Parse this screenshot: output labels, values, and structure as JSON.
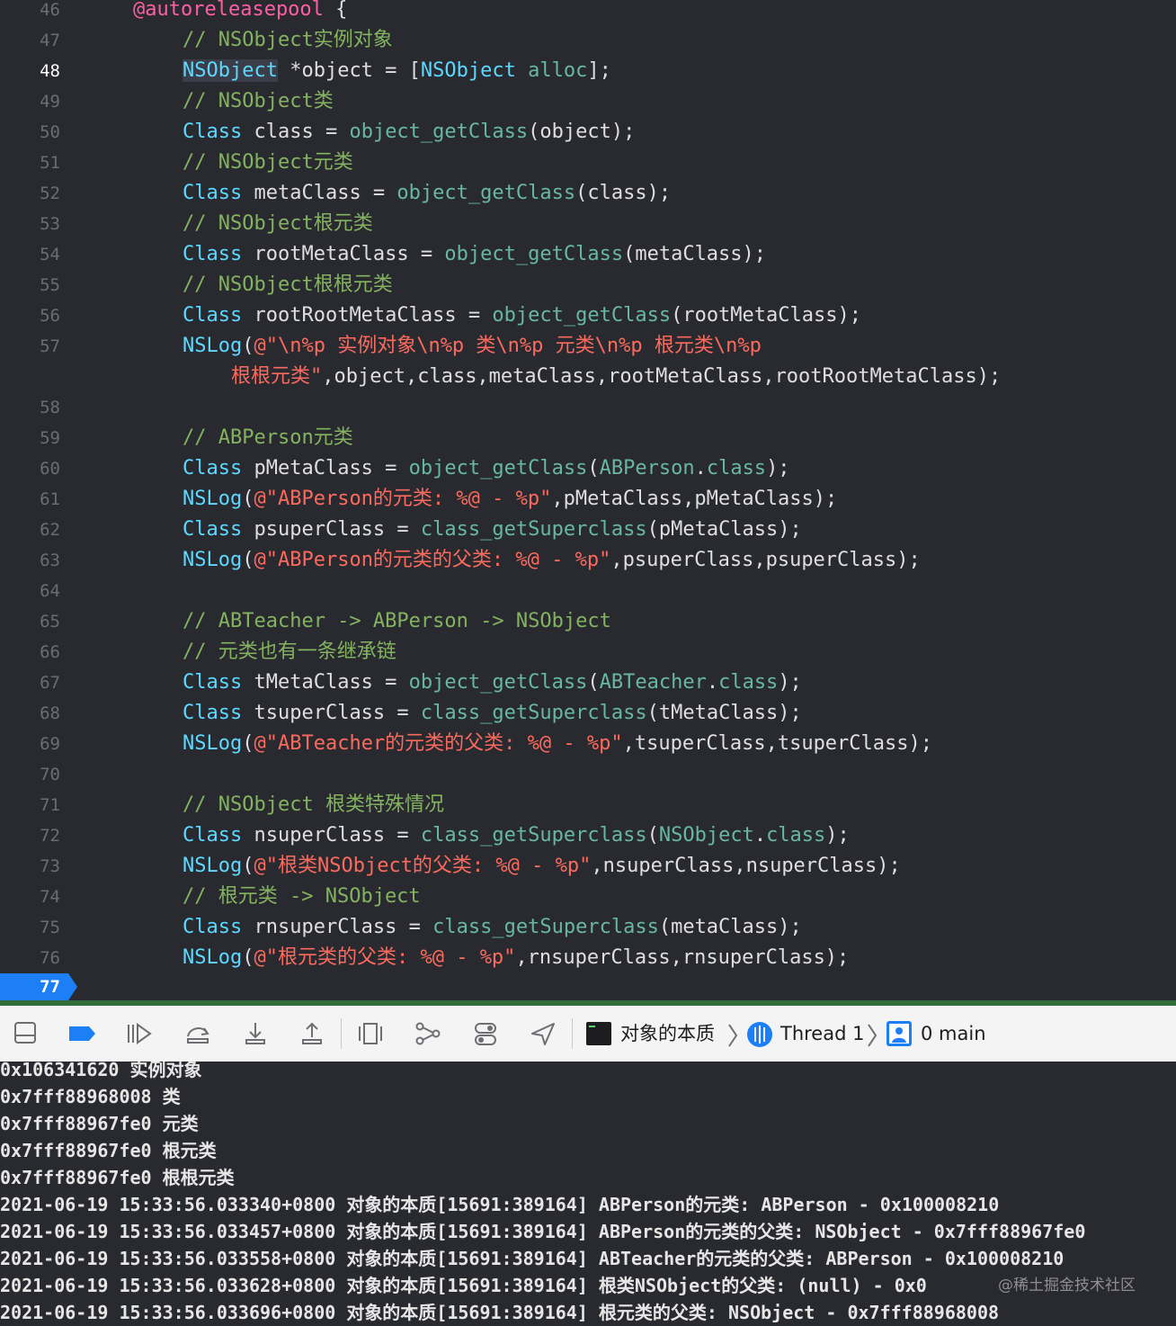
{
  "editor": {
    "lines": [
      {
        "number": "46",
        "tokens": [
          {
            "t": "@autoreleasepool",
            "c": "kw"
          },
          {
            "t": " {",
            "c": "pl"
          }
        ]
      },
      {
        "number": "47",
        "tokens": [
          {
            "t": "// NSObject实例对象",
            "c": "cm"
          }
        ]
      },
      {
        "number": "48",
        "current": true,
        "tokens": [
          {
            "t": "NSObject",
            "c": "ty hl"
          },
          {
            "t": " *object = [",
            "c": "pl"
          },
          {
            "t": "NSObject",
            "c": "ty"
          },
          {
            "t": " ",
            "c": "pl"
          },
          {
            "t": "alloc",
            "c": "fn"
          },
          {
            "t": "];",
            "c": "pl"
          }
        ]
      },
      {
        "number": "49",
        "tokens": [
          {
            "t": "// NSObject类",
            "c": "cm"
          }
        ]
      },
      {
        "number": "50",
        "tokens": [
          {
            "t": "Class",
            "c": "ty"
          },
          {
            "t": " class = ",
            "c": "pl"
          },
          {
            "t": "object_getClass",
            "c": "fn"
          },
          {
            "t": "(object);",
            "c": "pl"
          }
        ]
      },
      {
        "number": "51",
        "tokens": [
          {
            "t": "// NSObject元类",
            "c": "cm"
          }
        ]
      },
      {
        "number": "52",
        "tokens": [
          {
            "t": "Class",
            "c": "ty"
          },
          {
            "t": " metaClass = ",
            "c": "pl"
          },
          {
            "t": "object_getClass",
            "c": "fn"
          },
          {
            "t": "(class);",
            "c": "pl"
          }
        ]
      },
      {
        "number": "53",
        "tokens": [
          {
            "t": "// NSObject根元类",
            "c": "cm"
          }
        ]
      },
      {
        "number": "54",
        "tokens": [
          {
            "t": "Class",
            "c": "ty"
          },
          {
            "t": " rootMetaClass = ",
            "c": "pl"
          },
          {
            "t": "object_getClass",
            "c": "fn"
          },
          {
            "t": "(metaClass);",
            "c": "pl"
          }
        ]
      },
      {
        "number": "55",
        "tokens": [
          {
            "t": "// NSObject根根元类",
            "c": "cm"
          }
        ]
      },
      {
        "number": "56",
        "tokens": [
          {
            "t": "Class",
            "c": "ty"
          },
          {
            "t": " rootRootMetaClass = ",
            "c": "pl"
          },
          {
            "t": "object_getClass",
            "c": "fn"
          },
          {
            "t": "(rootMetaClass);",
            "c": "pl"
          }
        ]
      },
      {
        "number": "57",
        "tokens": [
          {
            "t": "NSLog",
            "c": "ty"
          },
          {
            "t": "(",
            "c": "pl"
          },
          {
            "t": "@\"\\n%p 实例对象\\n%p 类\\n%p 元类\\n%p 根元类\\n%p",
            "c": "st"
          }
        ]
      },
      {
        "number": "",
        "cont": true,
        "tokens": [
          {
            "t": "根根元类\"",
            "c": "st"
          },
          {
            "t": ",object,class,metaClass,rootMetaClass,rootRootMetaClass);",
            "c": "pl"
          }
        ]
      },
      {
        "number": "58",
        "tokens": []
      },
      {
        "number": "59",
        "tokens": [
          {
            "t": "// ABPerson元类",
            "c": "cm"
          }
        ]
      },
      {
        "number": "60",
        "tokens": [
          {
            "t": "Class",
            "c": "ty"
          },
          {
            "t": " pMetaClass = ",
            "c": "pl"
          },
          {
            "t": "object_getClass",
            "c": "fn"
          },
          {
            "t": "(",
            "c": "pl"
          },
          {
            "t": "ABPerson",
            "c": "fn"
          },
          {
            "t": ".",
            "c": "pl"
          },
          {
            "t": "class",
            "c": "fn"
          },
          {
            "t": ");",
            "c": "pl"
          }
        ]
      },
      {
        "number": "61",
        "tokens": [
          {
            "t": "NSLog",
            "c": "ty"
          },
          {
            "t": "(",
            "c": "pl"
          },
          {
            "t": "@\"ABPerson的元类: %@ - %p\"",
            "c": "st"
          },
          {
            "t": ",pMetaClass,pMetaClass);",
            "c": "pl"
          }
        ]
      },
      {
        "number": "62",
        "tokens": [
          {
            "t": "Class",
            "c": "ty"
          },
          {
            "t": " psuperClass = ",
            "c": "pl"
          },
          {
            "t": "class_getSuperclass",
            "c": "fn"
          },
          {
            "t": "(pMetaClass);",
            "c": "pl"
          }
        ]
      },
      {
        "number": "63",
        "tokens": [
          {
            "t": "NSLog",
            "c": "ty"
          },
          {
            "t": "(",
            "c": "pl"
          },
          {
            "t": "@\"ABPerson的元类的父类: %@ - %p\"",
            "c": "st"
          },
          {
            "t": ",psuperClass,psuperClass);",
            "c": "pl"
          }
        ]
      },
      {
        "number": "64",
        "tokens": []
      },
      {
        "number": "65",
        "tokens": [
          {
            "t": "// ABTeacher -> ABPerson -> NSObject",
            "c": "cm"
          }
        ]
      },
      {
        "number": "66",
        "tokens": [
          {
            "t": "// 元类也有一条继承链",
            "c": "cm"
          }
        ]
      },
      {
        "number": "67",
        "tokens": [
          {
            "t": "Class",
            "c": "ty"
          },
          {
            "t": " tMetaClass = ",
            "c": "pl"
          },
          {
            "t": "object_getClass",
            "c": "fn"
          },
          {
            "t": "(",
            "c": "pl"
          },
          {
            "t": "ABTeacher",
            "c": "fn"
          },
          {
            "t": ".",
            "c": "pl"
          },
          {
            "t": "class",
            "c": "fn"
          },
          {
            "t": ");",
            "c": "pl"
          }
        ]
      },
      {
        "number": "68",
        "tokens": [
          {
            "t": "Class",
            "c": "ty"
          },
          {
            "t": " tsuperClass = ",
            "c": "pl"
          },
          {
            "t": "class_getSuperclass",
            "c": "fn"
          },
          {
            "t": "(tMetaClass);",
            "c": "pl"
          }
        ]
      },
      {
        "number": "69",
        "tokens": [
          {
            "t": "NSLog",
            "c": "ty"
          },
          {
            "t": "(",
            "c": "pl"
          },
          {
            "t": "@\"ABTeacher的元类的父类: %@ - %p\"",
            "c": "st"
          },
          {
            "t": ",tsuperClass,tsuperClass);",
            "c": "pl"
          }
        ]
      },
      {
        "number": "70",
        "tokens": []
      },
      {
        "number": "71",
        "tokens": [
          {
            "t": "// NSObject 根类特殊情况",
            "c": "cm"
          }
        ]
      },
      {
        "number": "72",
        "tokens": [
          {
            "t": "Class",
            "c": "ty"
          },
          {
            "t": " nsuperClass = ",
            "c": "pl"
          },
          {
            "t": "class_getSuperclass",
            "c": "fn"
          },
          {
            "t": "(",
            "c": "pl"
          },
          {
            "t": "NSObject",
            "c": "fn"
          },
          {
            "t": ".",
            "c": "pl"
          },
          {
            "t": "class",
            "c": "fn"
          },
          {
            "t": ");",
            "c": "pl"
          }
        ]
      },
      {
        "number": "73",
        "tokens": [
          {
            "t": "NSLog",
            "c": "ty"
          },
          {
            "t": "(",
            "c": "pl"
          },
          {
            "t": "@\"根类NSObject的父类: %@ - %p\"",
            "c": "st"
          },
          {
            "t": ",nsuperClass,nsuperClass);",
            "c": "pl"
          }
        ]
      },
      {
        "number": "74",
        "tokens": [
          {
            "t": "// 根元类 -> NSObject",
            "c": "cm"
          }
        ]
      },
      {
        "number": "75",
        "tokens": [
          {
            "t": "Class",
            "c": "ty"
          },
          {
            "t": " rnsuperClass = ",
            "c": "pl"
          },
          {
            "t": "class_getSuperclass",
            "c": "fn"
          },
          {
            "t": "(metaClass);",
            "c": "pl"
          }
        ]
      },
      {
        "number": "76",
        "tokens": [
          {
            "t": "NSLog",
            "c": "ty"
          },
          {
            "t": "(",
            "c": "pl"
          },
          {
            "t": "@\"根元类的父类: %@ - %p\"",
            "c": "st"
          },
          {
            "t": ",rnsuperClass,rnsuperClass);",
            "c": "pl"
          }
        ]
      }
    ],
    "breakpoint_line": "77"
  },
  "debug_bar": {
    "buttons": [
      "hide-debug-area",
      "breakpoints-toggle",
      "continue",
      "step-over",
      "step-into",
      "step-out",
      "view-debugger",
      "memory-graph",
      "environment-overrides",
      "simulate-location"
    ],
    "breadcrumb": {
      "target": "对象的本质",
      "thread": "Thread 1",
      "frame": "0 main"
    }
  },
  "console": {
    "lines": [
      "0x106341620 实例对象",
      "0x7fff88968008 类",
      "0x7fff88967fe0 元类",
      "0x7fff88967fe0 根元类",
      "0x7fff88967fe0 根根元类",
      "2021-06-19 15:33:56.033340+0800 对象的本质[15691:389164] ABPerson的元类: ABPerson - 0x100008210",
      "2021-06-19 15:33:56.033457+0800 对象的本质[15691:389164] ABPerson的元类的父类: NSObject - 0x7fff88967fe0",
      "2021-06-19 15:33:56.033558+0800 对象的本质[15691:389164] ABTeacher的元类的父类: ABPerson - 0x100008210",
      "2021-06-19 15:33:56.033628+0800 对象的本质[15691:389164] 根类NSObject的父类: (null) - 0x0",
      "2021-06-19 15:33:56.033696+0800 对象的本质[15691:389164] 根元类的父类: NSObject - 0x7fff88968008"
    ],
    "watermark": "@稀土掘金技术社区"
  },
  "colors": {
    "background": "#292a30",
    "comment": "#84b360",
    "keyword": "#fc5fa3",
    "type": "#5dd8ff",
    "function": "#67b7a4",
    "string": "#fc6a5d",
    "breakpoint": "#1d7ff5"
  }
}
